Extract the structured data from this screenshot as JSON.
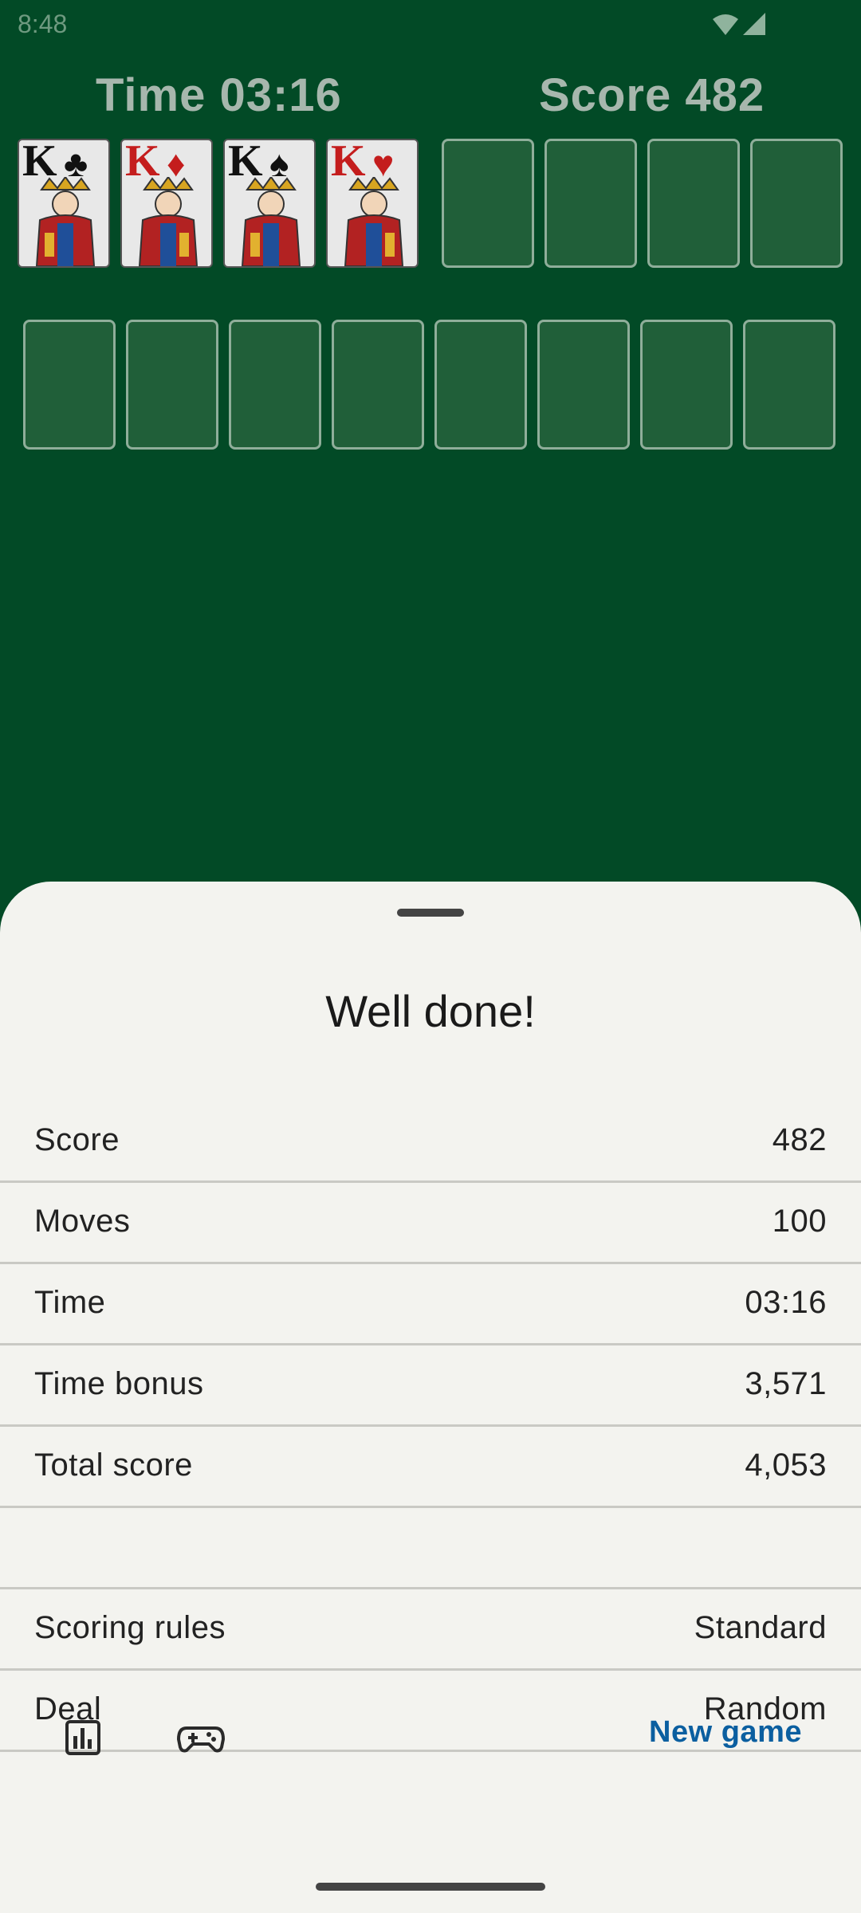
{
  "status_bar": {
    "time": "8:48"
  },
  "hud": {
    "time_label": "Time 03:16",
    "score_label": "Score 482"
  },
  "foundations": [
    {
      "rank": "K",
      "suit": "♣",
      "color": "black"
    },
    {
      "rank": "K",
      "suit": "♦",
      "color": "red"
    },
    {
      "rank": "K",
      "suit": "♠",
      "color": "black"
    },
    {
      "rank": "K",
      "suit": "♥",
      "color": "red"
    }
  ],
  "sheet": {
    "title": "Well done!",
    "stats": [
      {
        "label": "Score",
        "value": "482"
      },
      {
        "label": "Moves",
        "value": "100"
      },
      {
        "label": "Time",
        "value": "03:16"
      },
      {
        "label": "Time bonus",
        "value": "3,571"
      },
      {
        "label": "Total score",
        "value": "4,053"
      }
    ],
    "settings": [
      {
        "label": "Scoring rules",
        "value": "Standard"
      },
      {
        "label": "Deal",
        "value": "Random"
      }
    ],
    "actions": {
      "stats_icon": "bar-chart-icon",
      "games_icon": "gamepad-icon",
      "new_game_label": "New game"
    }
  },
  "colors": {
    "felt": "#024a26",
    "slot": "#205f39",
    "sheet": "#f3f3ef",
    "accent": "#0b5fa0"
  }
}
